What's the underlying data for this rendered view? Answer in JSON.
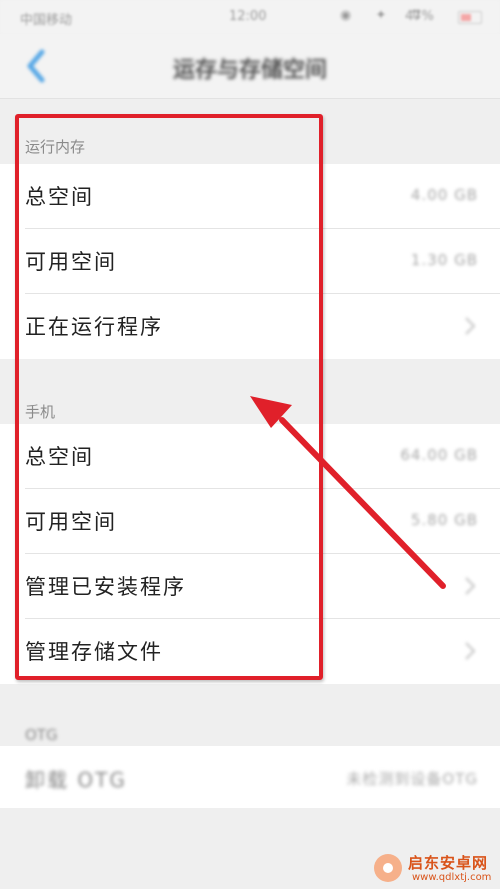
{
  "status_bar": {
    "carrier": "中国移动",
    "time": "12:00",
    "icons": "◉ ✦ ⇅",
    "battery": "47%"
  },
  "nav": {
    "back_icon": "chevron-left-icon",
    "title": "运存与存储空间"
  },
  "sections": [
    {
      "header": "运行内存",
      "rows": [
        {
          "label": "总空间",
          "value": "4.00 GB"
        },
        {
          "label": "可用空间",
          "value": "1.30 GB"
        },
        {
          "label": "正在运行程序",
          "value": ""
        }
      ]
    },
    {
      "header": "手机",
      "rows": [
        {
          "label": "总空间",
          "value": "64.00 GB"
        },
        {
          "label": "可用空间",
          "value": "5.80 GB"
        },
        {
          "label": "管理已安装程序",
          "value": ""
        },
        {
          "label": "管理存储文件",
          "value": ""
        }
      ]
    }
  ],
  "otg": {
    "header": "OTG",
    "label": "卸载 OTG",
    "value": "未检测到设备OTG"
  },
  "colors": {
    "highlight": "#e0202a",
    "accent_blue": "#5aa9e6"
  },
  "watermark": {
    "title": "启东安卓网",
    "url": "www.qdlxtj.com"
  }
}
